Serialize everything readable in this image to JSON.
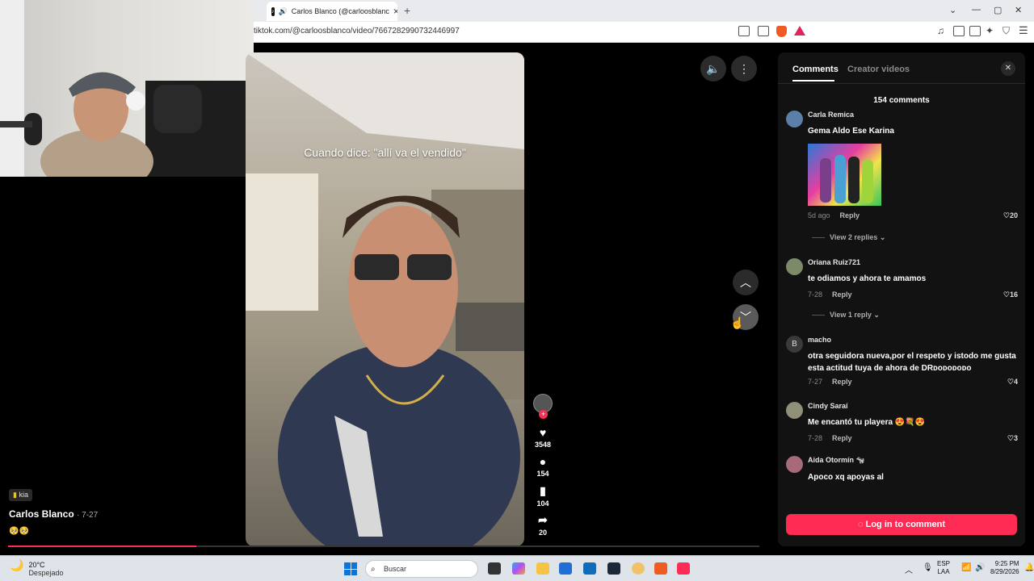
{
  "browser": {
    "tab_title": "Carlos Blanco (@carloosblanc",
    "address": "tiktok.com/@carloosblanco/video/7667282990732446997"
  },
  "video": {
    "caption": "Cuando dice: \"allí va el vendido\"",
    "author": "Carlos Blanco",
    "date": "· 7-27",
    "badge": "kia",
    "emoji_line": "🥺🥺",
    "progress": 0.25,
    "actions": {
      "likes": "3548",
      "comments": "154",
      "saves": "104",
      "shares": "20"
    }
  },
  "comments_panel": {
    "tab_comments": "Comments",
    "tab_creator": "Creator videos",
    "count": "154 comments",
    "login_label": "Log in to comment",
    "comments": [
      {
        "name": "Carla Remica",
        "text": "Gema Aldo Ese Karina",
        "time": "5d ago",
        "reply": "Reply",
        "likes": "20",
        "view_replies": "View 2 replies ⌄"
      },
      {
        "name": "Oriana Ruiz721",
        "text": "te odiamos y ahora te amamos",
        "time": "7-28",
        "reply": "Reply",
        "likes": "16",
        "view_replies": "View 1 reply ⌄"
      },
      {
        "name": "macho",
        "avatar_letter": "B",
        "text": "otra seguidora nueva,por el respeto y istodo me gusta esta actitud tuya de ahora de DRᴅᴏᴅᴏᴅᴏᴅᴏ",
        "time": "7-27",
        "reply": "Reply",
        "likes": "4"
      },
      {
        "name": "Cindy Saraí",
        "text": "Me encantó tu playera 😍💐😍",
        "time": "7-28",
        "reply": "Reply",
        "likes": "3"
      },
      {
        "name": "Aida Otormín 🐄",
        "text": "Apoco xq apoyas al"
      }
    ]
  },
  "taskbar": {
    "temp": "20°C",
    "weather": "Despejado",
    "search": "Buscar",
    "lang": "ESP",
    "lang2": "LAA",
    "time": "9:25 PM",
    "date": "8/29/2026"
  },
  "colors": {
    "accent": "#fe2c55",
    "panel": "#121212"
  }
}
